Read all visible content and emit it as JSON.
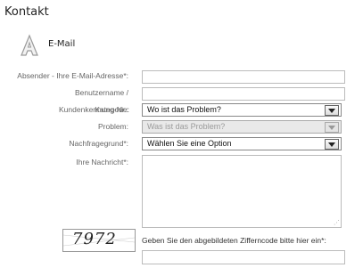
{
  "page": {
    "title": "Kontakt"
  },
  "channel": {
    "icon": "email-icon",
    "label": "E-Mail"
  },
  "form": {
    "sender_label": "Absender - Ihre E-Mail-Adresse*:",
    "sender_value": "",
    "username_label": "Benutzername /",
    "username_value": "",
    "customer_no_label": "Kundenkennung-Nr.:",
    "category_label": "Kategorie:",
    "category_value": "Wo ist das Problem?",
    "problem_label": "Problem:",
    "problem_value": "Was ist das Problem?",
    "reason_label": "Nachfragegrund*:",
    "reason_value": "Wählen Sie eine Option",
    "message_label": "Ihre Nachricht*:",
    "message_value": "",
    "captcha_code": "7972",
    "captcha_hint": "Geben Sie den abgebildeten Zifferncode bitte hier ein*:",
    "captcha_value": ""
  }
}
